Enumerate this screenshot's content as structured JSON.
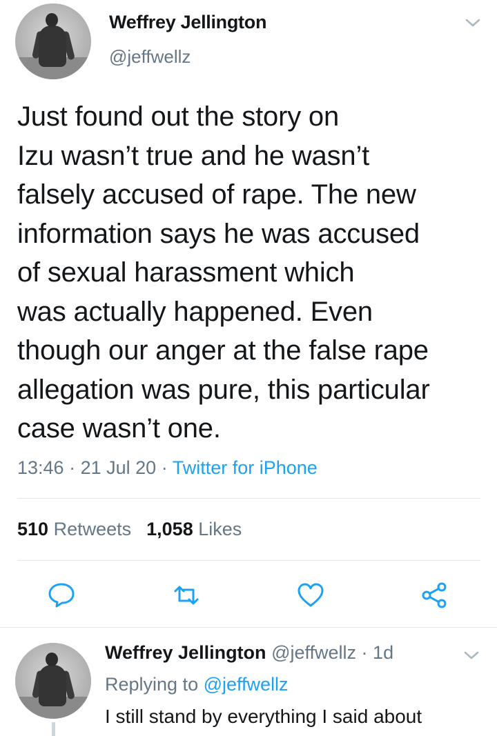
{
  "tweet": {
    "author_name": "Weffrey Jellington",
    "author_handle": "@jeffwellz",
    "text": "Just found out the story on\nIzu wasn’t true and he wasn’t\nfalsely accused of rape. The new\ninformation says he was accused\nof sexual harassment which\nwas actually happened. Even\nthough our anger at the false rape\nallegation was pure, this particular\ncase wasn’t one.",
    "time": "13:46",
    "date": "21 Jul 20",
    "separator": "·",
    "source": "Twitter for iPhone",
    "retweets_count": "510",
    "retweets_label": "Retweets",
    "likes_count": "1,058",
    "likes_label": "Likes"
  },
  "reply": {
    "author_name": "Weffrey Jellington",
    "author_handle": "@jeffwellz",
    "age": "1d",
    "separator": "·",
    "replying_to_label": "Replying to",
    "replying_to_handle": "@jeffwellz",
    "text": "I still stand by everything I said about"
  },
  "icons": {
    "more": "chevron-down-icon",
    "reply": "reply-icon",
    "retweet": "retweet-icon",
    "like": "heart-icon",
    "share": "share-icon"
  },
  "colors": {
    "primary_text": "#14171a",
    "secondary_text": "#657786",
    "link": "#1da1f2",
    "action_icon": "#1da1f2",
    "divider": "#e1e8ed"
  }
}
